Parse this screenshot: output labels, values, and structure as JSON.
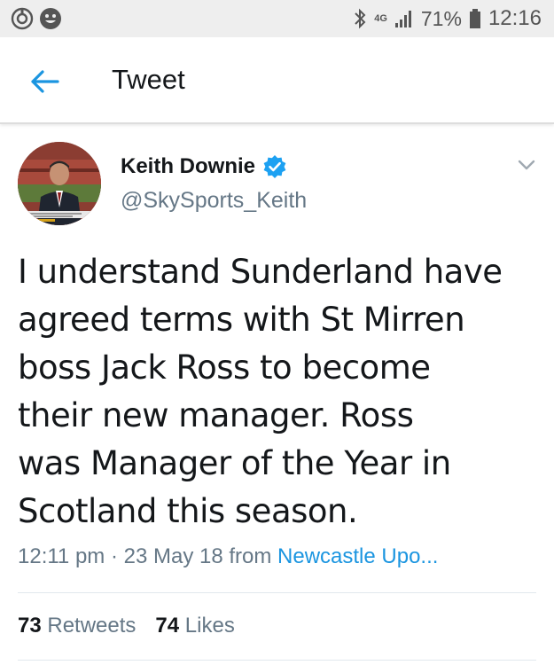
{
  "status_bar": {
    "network": "4G",
    "battery": "71%",
    "time": "12:16"
  },
  "header": {
    "title": "Tweet"
  },
  "tweet": {
    "author_name": "Keith Downie",
    "author_handle": "@SkySports_Keith",
    "text_lines": [
      "I understand Sunderland have",
      "agreed terms with St Mirren",
      "boss Jack Ross to become",
      "their new manager. Ross",
      "was Manager of the Year in",
      "Scotland this season."
    ],
    "timestamp": "12:11 pm · 23 May 18 from ",
    "source": "Newcastle Upo...",
    "retweets_count": "73",
    "retweets_label": "Retweets",
    "likes_count": "74",
    "likes_label": "Likes"
  },
  "colors": {
    "accent": "#1b95e0",
    "verified": "#1da1f2",
    "secondary_text": "#657786",
    "status_bar_bg": "#eeeeee"
  },
  "icons": [
    "notification-icon",
    "face-icon",
    "bluetooth-icon",
    "signal-icon",
    "battery-icon",
    "back-arrow-icon",
    "verified-badge-icon",
    "chevron-down-icon"
  ]
}
